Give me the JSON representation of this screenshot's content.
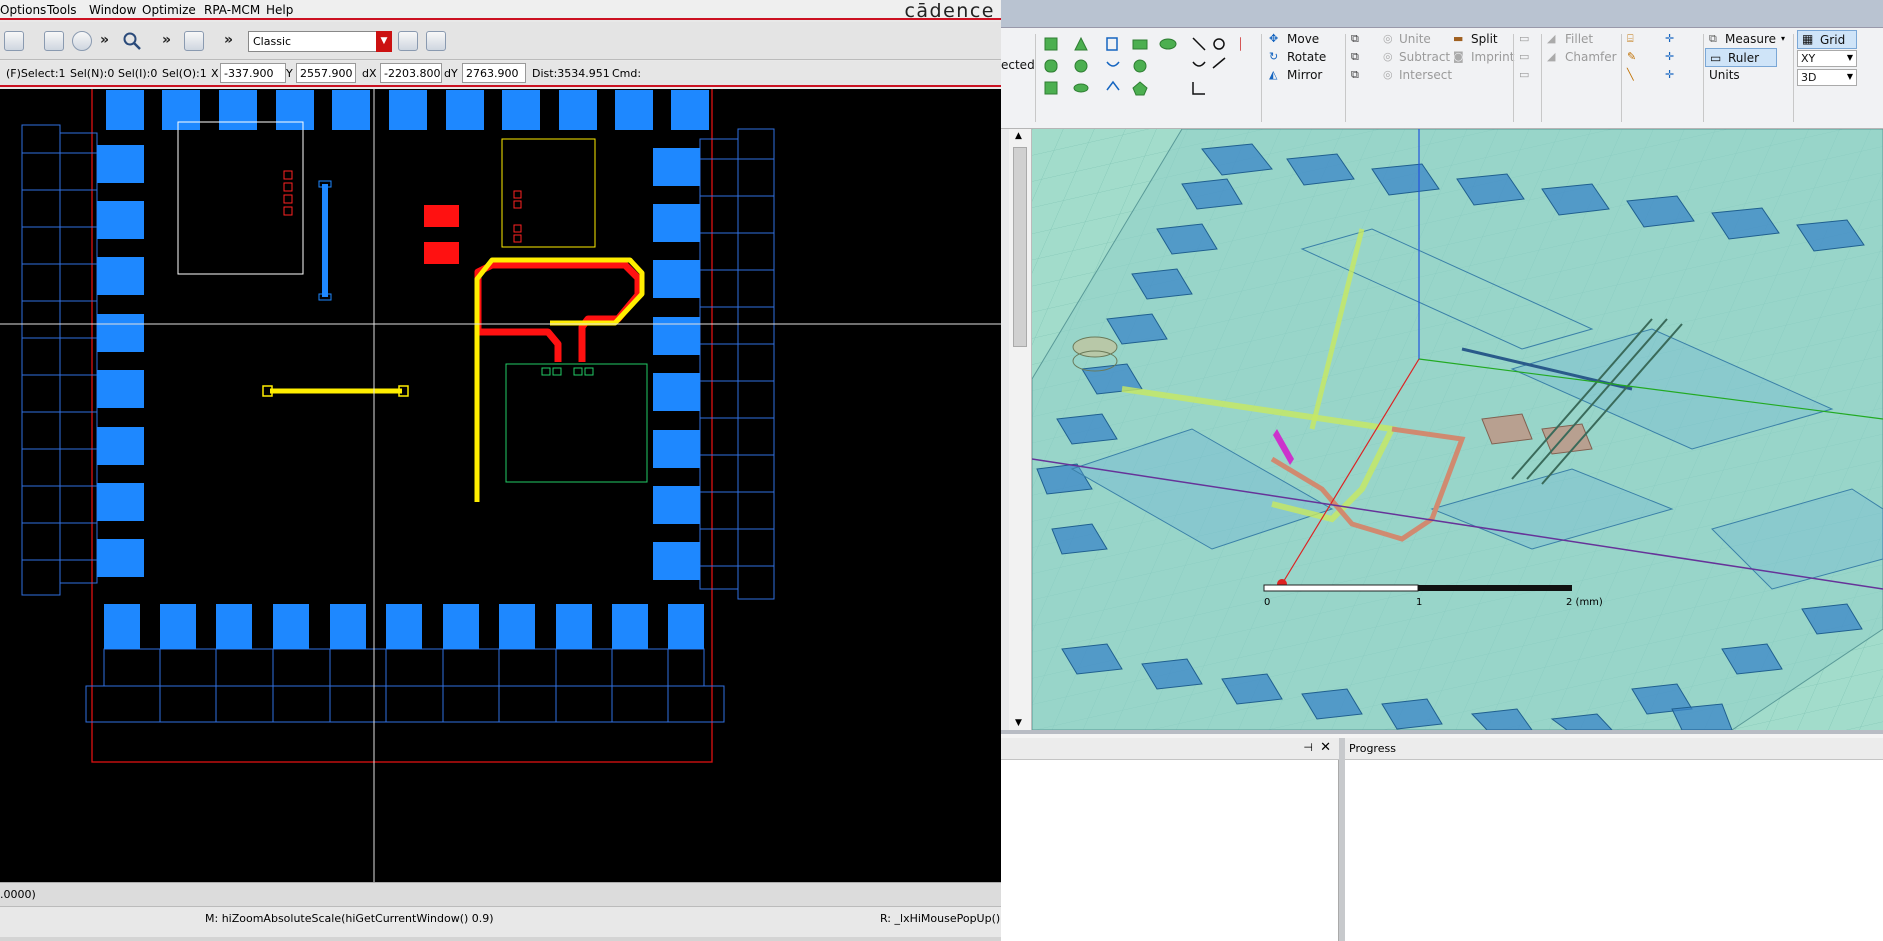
{
  "cadence": {
    "menus": [
      "Options",
      "Tools",
      "Window",
      "Optimize",
      "RPA-MCM",
      "Help"
    ],
    "brand": "cādence",
    "toolbar": {
      "more1": "»",
      "more2": "»",
      "more3": "»",
      "style_value": "Classic"
    },
    "status": {
      "select": "(F)Select:1",
      "seln": "Sel(N):0",
      "seli": "Sel(I):0",
      "selo": "Sel(O):1",
      "x_label": "X",
      "x_value": "-337.900",
      "y_label": "Y",
      "y_value": "2557.900",
      "dx_label": "dX",
      "dx_value": "-2203.800",
      "dy_label": "dY",
      "dy_value": "2763.900",
      "dist": "Dist:3534.951",
      "cmd": "Cmd:"
    },
    "bottom_text": ".0000)",
    "mouse_left": "M: hiZoomAbsoluteScale(hiGetCurrentWindow() 0.9)",
    "mouse_right": "R: _lxHiMousePopUp()"
  },
  "hfss": {
    "ribbon": {
      "partial_left": "ected",
      "move": "Move",
      "rotate": "Rotate",
      "mirror": "Mirror",
      "unite": "Unite",
      "subtract": "Subtract",
      "intersect": "Intersect",
      "split": "Split",
      "imprint": "Imprint",
      "fillet": "Fillet",
      "chamfer": "Chamfer",
      "measure": "Measure",
      "ruler": "Ruler",
      "units": "Units",
      "grid": "Grid",
      "plane": "XY",
      "mode": "3D"
    },
    "view": {
      "scale_labels": [
        "0",
        "1",
        "2 (mm)"
      ]
    },
    "progress_title": "Progress"
  },
  "colors": {
    "cadence_red": "#cc1122",
    "pad_blue": "#1e88ff",
    "trace_yellow": "#ffee00",
    "trace_red": "#ff1111",
    "hfss_bg": "#9fd8c8"
  }
}
